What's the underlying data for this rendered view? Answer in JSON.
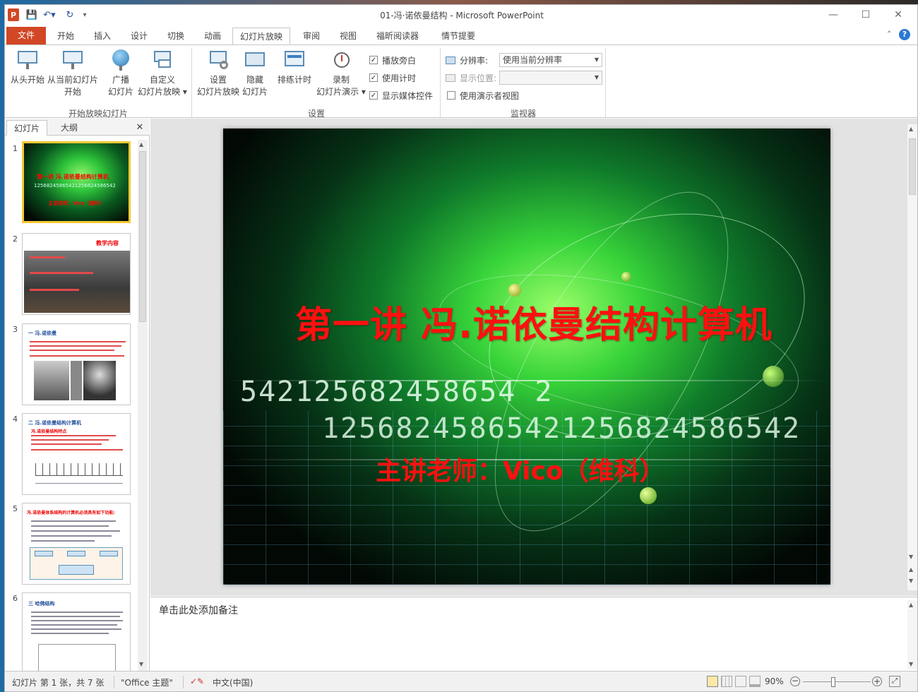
{
  "window": {
    "title": "01-冯·诺依曼结构 - Microsoft PowerPoint",
    "app_icon": "P"
  },
  "quick_access": {
    "save_icon": "save-icon",
    "undo_icon": "undo-icon",
    "redo_icon": "redo-icon"
  },
  "tabs": [
    {
      "label": "文件"
    },
    {
      "label": "开始"
    },
    {
      "label": "插入"
    },
    {
      "label": "设计"
    },
    {
      "label": "切换"
    },
    {
      "label": "动画"
    },
    {
      "label": "幻灯片放映"
    },
    {
      "label": "审阅"
    },
    {
      "label": "视图"
    },
    {
      "label": "福昕阅读器"
    },
    {
      "label": "情节提要"
    }
  ],
  "ribbon": {
    "start_group": {
      "label": "开始放映幻灯片",
      "from_beginning": "从头开始",
      "from_current_1": "从当前幻灯片",
      "from_current_2": "开始",
      "broadcast_1": "广播",
      "broadcast_2": "幻灯片",
      "custom_1": "自定义",
      "custom_2": "幻灯片放映 ▾"
    },
    "setup_group": {
      "label": "设置",
      "setup_1": "设置",
      "setup_2": "幻灯片放映",
      "hide_1": "隐藏",
      "hide_2": "幻灯片",
      "rehearse": "排练计时",
      "record_1": "录制",
      "record_2": "幻灯片演示 ▾",
      "play_narration": "播放旁白",
      "use_timings": "使用计时",
      "show_media": "显示媒体控件"
    },
    "monitor_group": {
      "label": "监视器",
      "resolution_label": "分辨率:",
      "resolution_value": "使用当前分辨率",
      "display_label": "显示位置:",
      "display_value": "",
      "presenter_view": "使用演示者视图"
    }
  },
  "left_pane": {
    "tab_slides": "幻灯片",
    "tab_outline": "大纲",
    "close": "✕",
    "thumbnails": [
      {
        "num": "1",
        "title": "第一讲 冯.诺依曼结构计算机",
        "digits": "12568245865421256824586542",
        "subtitle": "主讲老师：Vico（维科）"
      },
      {
        "num": "2",
        "title": "教学内容"
      },
      {
        "num": "3",
        "title": "一 冯.诺依曼"
      },
      {
        "num": "4",
        "title": "二 冯.诺依曼结构计算机",
        "subtitle": "冯.诺依曼结构特点"
      },
      {
        "num": "5",
        "title": "冯.诺依曼体系结构的计算机必须具有如下功能:"
      },
      {
        "num": "6",
        "title": "三 哈佛结构"
      }
    ]
  },
  "slide": {
    "title": "第一讲 冯.诺依曼结构计算机",
    "digits_row1": "542125682458654 2",
    "digits_row2": "12568245865421256824586542",
    "presenter": "主讲老师：Vico（维科）"
  },
  "notes": {
    "placeholder": "单击此处添加备注"
  },
  "status": {
    "slide_info": "幻灯片 第 1 张，共 7 张",
    "theme": "\"Office 主题\"",
    "language": "中文(中国)",
    "zoom": "90%"
  }
}
